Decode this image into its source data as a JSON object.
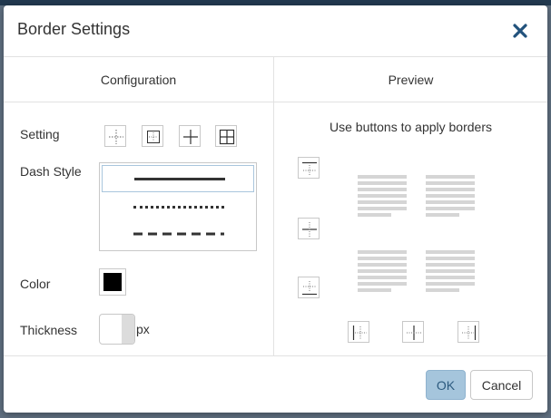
{
  "dialog": {
    "title": "Border Settings",
    "close_icon": "close-icon",
    "accent_color": "#22527c"
  },
  "columns": {
    "configuration": "Configuration",
    "preview": "Preview"
  },
  "config": {
    "setting_label": "Setting",
    "setting_icons": [
      "border-inner-dotted-icon",
      "border-outer-icon",
      "border-inner-icon",
      "border-all-icon"
    ],
    "dash_style_label": "Dash Style",
    "dash_styles": [
      "solid",
      "dotted",
      "dashed"
    ],
    "dash_style_selected": "solid",
    "color_label": "Color",
    "color_value": "#000000",
    "thickness_label": "Thickness",
    "thickness_value": "",
    "thickness_unit": "px"
  },
  "preview": {
    "hint": "Use buttons to apply borders",
    "left_buttons": [
      "border-top-icon",
      "border-middle-horizontal-icon",
      "border-bottom-icon"
    ],
    "bottom_buttons": [
      "border-left-icon",
      "border-middle-vertical-icon",
      "border-right-icon"
    ]
  },
  "footer": {
    "ok_label": "OK",
    "cancel_label": "Cancel"
  }
}
